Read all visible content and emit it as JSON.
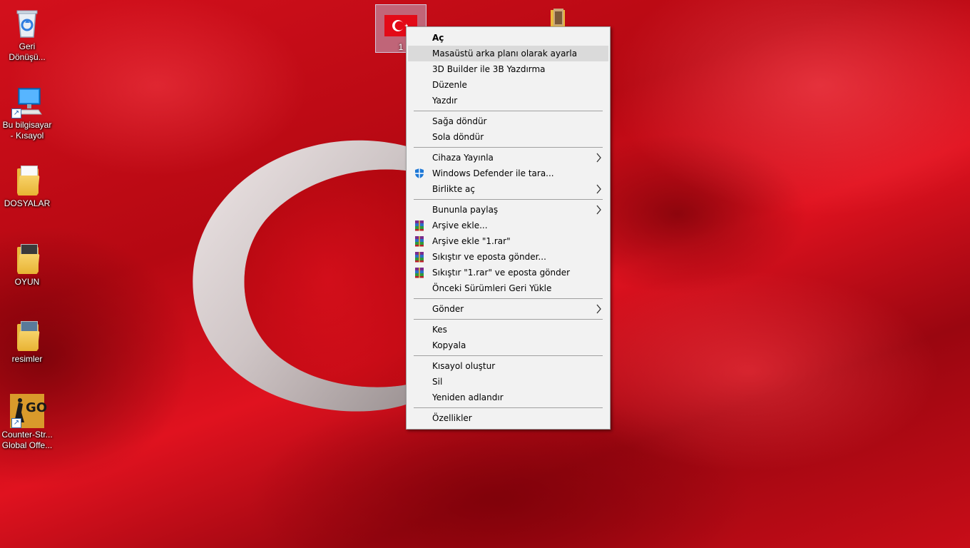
{
  "desktop": {
    "icons": [
      {
        "label": "Geri Dönüşü...",
        "icon": "recycle-bin-icon"
      },
      {
        "label": "Bu bilgisayar - Kısayol",
        "icon": "computer-icon"
      },
      {
        "label": "DOSYALAR",
        "icon": "folder-icon"
      },
      {
        "label": "OYUN",
        "icon": "folder-icon"
      },
      {
        "label": "resimler",
        "icon": "folder-icon"
      },
      {
        "label": "Counter-Str... Global Offe...",
        "icon": "csgo-game-icon"
      }
    ],
    "selected_item": {
      "label": "1",
      "icon": "image-file-icon"
    },
    "shortcut_arrow_glyph": "↗",
    "go_glyph": "GO"
  },
  "context_menu": {
    "submenu_arrow_glyph": "›",
    "groups": [
      [
        {
          "label": "Aç",
          "bold": true
        },
        {
          "label": "Masaüstü arka planı olarak ayarla",
          "hover": true
        },
        {
          "label": "3D Builder ile 3B Yazdırma"
        },
        {
          "label": "Düzenle"
        },
        {
          "label": "Yazdır"
        }
      ],
      [
        {
          "label": "Sağa döndür"
        },
        {
          "label": "Sola döndür"
        }
      ],
      [
        {
          "label": "Cihaza Yayınla",
          "submenu": true
        },
        {
          "label": "Windows Defender ile tara...",
          "icon": "windows-defender-icon"
        },
        {
          "label": "Birlikte aç",
          "submenu": true
        }
      ],
      [
        {
          "label": "Bununla paylaş",
          "submenu": true
        },
        {
          "label": "Arşive ekle...",
          "icon": "winrar-icon"
        },
        {
          "label": "Arşive ekle \"1.rar\"",
          "icon": "winrar-icon"
        },
        {
          "label": "Sıkıştır ve eposta gönder...",
          "icon": "winrar-icon"
        },
        {
          "label": "Sıkıştır \"1.rar\" ve eposta gönder",
          "icon": "winrar-icon"
        },
        {
          "label": "Önceki Sürümleri Geri Yükle"
        }
      ],
      [
        {
          "label": "Gönder",
          "submenu": true
        }
      ],
      [
        {
          "label": "Kes"
        },
        {
          "label": "Kopyala"
        }
      ],
      [
        {
          "label": "Kısayol oluştur"
        },
        {
          "label": "Sil"
        },
        {
          "label": "Yeniden adlandır"
        }
      ],
      [
        {
          "label": "Özellikler"
        }
      ]
    ]
  }
}
